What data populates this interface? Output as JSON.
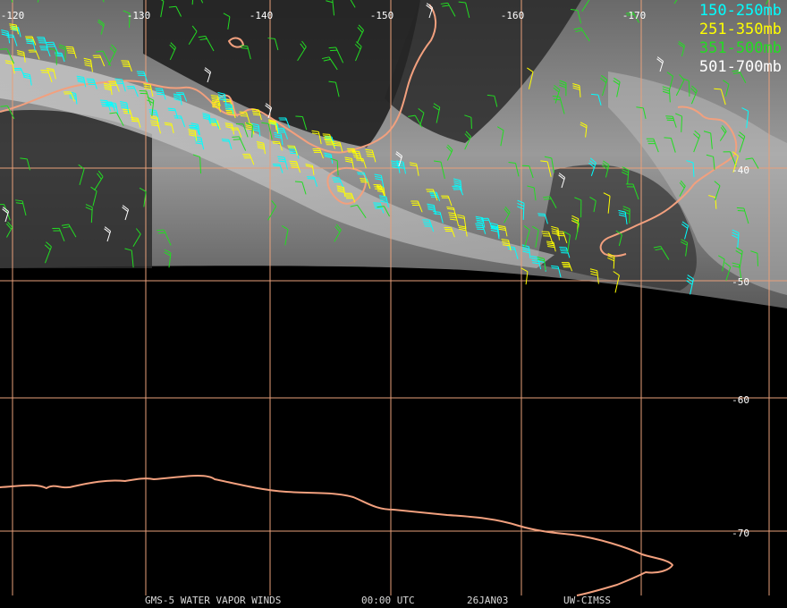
{
  "map": {
    "longitude_labels": [
      "-120",
      "-130",
      "-140",
      "-150",
      "-160",
      "-170"
    ],
    "latitude_labels": [
      "-40",
      "-50",
      "-60",
      "-70"
    ],
    "colors": {
      "grid": "#e8a07a",
      "coast": "#f2a07e",
      "vapor_light": "#bdbdbd",
      "vapor_dark": "#3a3a3a"
    }
  },
  "legend": {
    "items": [
      {
        "label": "150-250mb",
        "color": "#00ffff"
      },
      {
        "label": "251-350mb",
        "color": "#ffff00"
      },
      {
        "label": "351-500mb",
        "color": "#22dd22"
      },
      {
        "label": "501-700mb",
        "color": "#ffffff"
      }
    ]
  },
  "footer": {
    "product": "GMS-5 WATER VAPOR WINDS",
    "time": "00:00 UTC",
    "date": "26JAN03",
    "source": "UW-CIMSS"
  }
}
